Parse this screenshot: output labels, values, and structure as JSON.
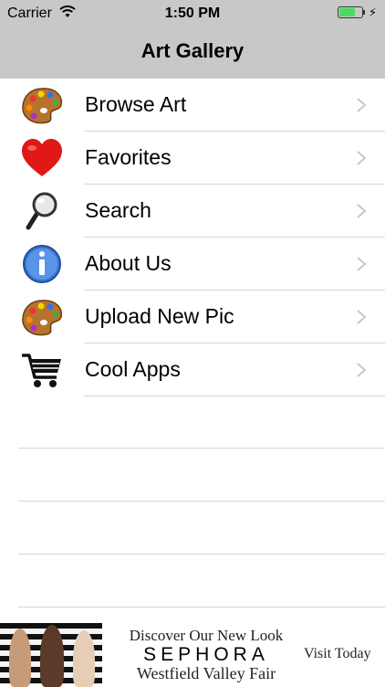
{
  "status_bar": {
    "carrier": "Carrier",
    "time": "1:50 PM",
    "battery_level": 0.75
  },
  "nav": {
    "title": "Art Gallery"
  },
  "menu": {
    "items": [
      {
        "label": "Browse Art",
        "icon": "palette-icon"
      },
      {
        "label": "Favorites",
        "icon": "heart-icon"
      },
      {
        "label": "Search",
        "icon": "magnifier-icon"
      },
      {
        "label": "About Us",
        "icon": "info-icon"
      },
      {
        "label": "Upload New Pic",
        "icon": "palette-icon"
      },
      {
        "label": "Cool Apps",
        "icon": "shopping-cart-icon"
      }
    ]
  },
  "ad": {
    "line1": "Discover Our New Look",
    "brand": "SEPHORA",
    "line3": "Westfield Valley Fair",
    "cta": "Visit Today"
  },
  "colors": {
    "bar_background": "#c8c8c8",
    "battery_fill": "#4cd964",
    "separator": "#d6d6d6",
    "chevron": "#c7c7cc"
  }
}
